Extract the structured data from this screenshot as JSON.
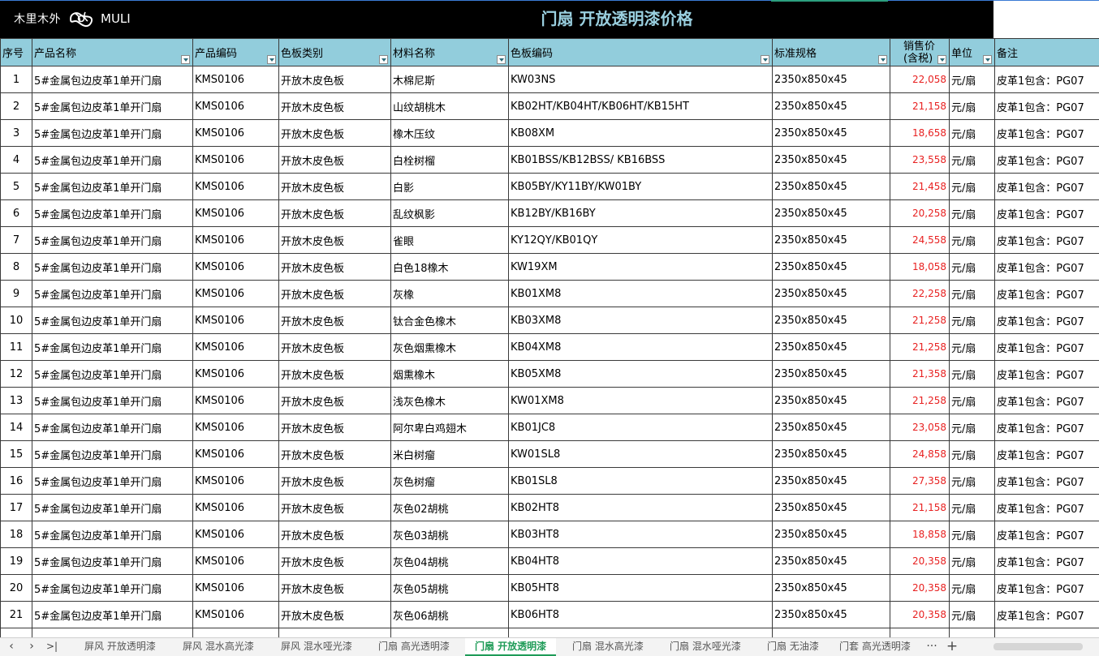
{
  "banner": {
    "logo_cn": "木里木外",
    "logo_en": "MULI",
    "title": "门扇 开放透明漆价格"
  },
  "table": {
    "headers": {
      "seq": "序号",
      "name": "产品名称",
      "code": "产品编码",
      "category": "色板类别",
      "material": "材料名称",
      "board": "色板编码",
      "spec": "标准规格",
      "price_line1": "销售价",
      "price_line2": "(含税)",
      "unit": "单位",
      "note": "备注"
    },
    "rows": [
      {
        "seq": "1",
        "name": "5#金属包边皮革1单开门扇",
        "code": "KMS0106",
        "category": "开放木皮色板",
        "material": "木棉尼斯",
        "board": "KW03NS",
        "spec": "2350x850x45",
        "price": "22,058",
        "unit": "元/扇",
        "note": "皮革1包含：PG07"
      },
      {
        "seq": "2",
        "name": "5#金属包边皮革1单开门扇",
        "code": "KMS0106",
        "category": "开放木皮色板",
        "material": "山纹胡桃木",
        "board": "KB02HT/KB04HT/KB06HT/KB15HT",
        "spec": "2350x850x45",
        "price": "21,158",
        "unit": "元/扇",
        "note": "皮革1包含：PG07"
      },
      {
        "seq": "3",
        "name": "5#金属包边皮革1单开门扇",
        "code": "KMS0106",
        "category": "开放木皮色板",
        "material": "橡木压纹",
        "board": "KB08XM",
        "spec": "2350x850x45",
        "price": "18,658",
        "unit": "元/扇",
        "note": "皮革1包含：PG07"
      },
      {
        "seq": "4",
        "name": "5#金属包边皮革1单开门扇",
        "code": "KMS0106",
        "category": "开放木皮色板",
        "material": "白栓树榴",
        "board": "KB01BSS/KB12BSS/ KB16BSS",
        "spec": "2350x850x45",
        "price": "23,558",
        "unit": "元/扇",
        "note": "皮革1包含：PG07"
      },
      {
        "seq": "5",
        "name": "5#金属包边皮革1单开门扇",
        "code": "KMS0106",
        "category": "开放木皮色板",
        "material": "白影",
        "board": "KB05BY/KY11BY/KW01BY",
        "spec": "2350x850x45",
        "price": "21,458",
        "unit": "元/扇",
        "note": "皮革1包含：PG07"
      },
      {
        "seq": "6",
        "name": "5#金属包边皮革1单开门扇",
        "code": "KMS0106",
        "category": "开放木皮色板",
        "material": "乱纹枫影",
        "board": "KB12BY/KB16BY",
        "spec": "2350x850x45",
        "price": "20,258",
        "unit": "元/扇",
        "note": "皮革1包含：PG07"
      },
      {
        "seq": "7",
        "name": "5#金属包边皮革1单开门扇",
        "code": "KMS0106",
        "category": "开放木皮色板",
        "material": "雀眼",
        "board": "KY12QY/KB01QY",
        "spec": "2350x850x45",
        "price": "24,558",
        "unit": "元/扇",
        "note": "皮革1包含：PG07"
      },
      {
        "seq": "8",
        "name": "5#金属包边皮革1单开门扇",
        "code": "KMS0106",
        "category": "开放木皮色板",
        "material": "白色18橡木",
        "board": "KW19XM",
        "spec": "2350x850x45",
        "price": "18,058",
        "unit": "元/扇",
        "note": "皮革1包含：PG07"
      },
      {
        "seq": "9",
        "name": "5#金属包边皮革1单开门扇",
        "code": "KMS0106",
        "category": "开放木皮色板",
        "material": "灰橡",
        "board": "KB01XM8",
        "spec": "2350x850x45",
        "price": "22,258",
        "unit": "元/扇",
        "note": "皮革1包含：PG07"
      },
      {
        "seq": "10",
        "name": "5#金属包边皮革1单开门扇",
        "code": "KMS0106",
        "category": "开放木皮色板",
        "material": "钛合金色橡木",
        "board": "KB03XM8",
        "spec": "2350x850x45",
        "price": "21,258",
        "unit": "元/扇",
        "note": "皮革1包含：PG07"
      },
      {
        "seq": "11",
        "name": "5#金属包边皮革1单开门扇",
        "code": "KMS0106",
        "category": "开放木皮色板",
        "material": "灰色烟熏橡木",
        "board": "KB04XM8",
        "spec": "2350x850x45",
        "price": "21,258",
        "unit": "元/扇",
        "note": "皮革1包含：PG07"
      },
      {
        "seq": "12",
        "name": "5#金属包边皮革1单开门扇",
        "code": "KMS0106",
        "category": "开放木皮色板",
        "material": "烟熏橡木",
        "board": "KB05XM8",
        "spec": "2350x850x45",
        "price": "21,358",
        "unit": "元/扇",
        "note": "皮革1包含：PG07"
      },
      {
        "seq": "13",
        "name": "5#金属包边皮革1单开门扇",
        "code": "KMS0106",
        "category": "开放木皮色板",
        "material": "浅灰色橡木",
        "board": "KW01XM8",
        "spec": "2350x850x45",
        "price": "21,258",
        "unit": "元/扇",
        "note": "皮革1包含：PG07"
      },
      {
        "seq": "14",
        "name": "5#金属包边皮革1单开门扇",
        "code": "KMS0106",
        "category": "开放木皮色板",
        "material": "阿尔卑白鸡翅木",
        "board": "KB01JC8",
        "spec": "2350x850x45",
        "price": "23,058",
        "unit": "元/扇",
        "note": "皮革1包含：PG07"
      },
      {
        "seq": "15",
        "name": "5#金属包边皮革1单开门扇",
        "code": "KMS0106",
        "category": "开放木皮色板",
        "material": "米白树瘤",
        "board": "KW01SL8",
        "spec": "2350x850x45",
        "price": "24,858",
        "unit": "元/扇",
        "note": "皮革1包含：PG07"
      },
      {
        "seq": "16",
        "name": "5#金属包边皮革1单开门扇",
        "code": "KMS0106",
        "category": "开放木皮色板",
        "material": "灰色树瘤",
        "board": "KB01SL8",
        "spec": "2350x850x45",
        "price": "27,358",
        "unit": "元/扇",
        "note": "皮革1包含：PG07"
      },
      {
        "seq": "17",
        "name": "5#金属包边皮革1单开门扇",
        "code": "KMS0106",
        "category": "开放木皮色板",
        "material": "灰色02胡桃",
        "board": "KB02HT8",
        "spec": "2350x850x45",
        "price": "21,158",
        "unit": "元/扇",
        "note": "皮革1包含：PG07"
      },
      {
        "seq": "18",
        "name": "5#金属包边皮革1单开门扇",
        "code": "KMS0106",
        "category": "开放木皮色板",
        "material": "灰色03胡桃",
        "board": "KB03HT8",
        "spec": "2350x850x45",
        "price": "18,858",
        "unit": "元/扇",
        "note": "皮革1包含：PG07"
      },
      {
        "seq": "19",
        "name": "5#金属包边皮革1单开门扇",
        "code": "KMS0106",
        "category": "开放木皮色板",
        "material": "灰色04胡桃",
        "board": "KB04HT8",
        "spec": "2350x850x45",
        "price": "20,358",
        "unit": "元/扇",
        "note": "皮革1包含：PG07"
      },
      {
        "seq": "20",
        "name": "5#金属包边皮革1单开门扇",
        "code": "KMS0106",
        "category": "开放木皮色板",
        "material": "灰色05胡桃",
        "board": "KB05HT8",
        "spec": "2350x850x45",
        "price": "20,358",
        "unit": "元/扇",
        "note": "皮革1包含：PG07"
      },
      {
        "seq": "21",
        "name": "5#金属包边皮革1单开门扇",
        "code": "KMS0106",
        "category": "开放木皮色板",
        "material": "灰色06胡桃",
        "board": "KB06HT8",
        "spec": "2350x850x45",
        "price": "20,358",
        "unit": "元/扇",
        "note": "皮革1包含：PG07"
      }
    ]
  },
  "tabs": [
    {
      "label": "屏风 开放透明漆",
      "active": false
    },
    {
      "label": "屏风 混水高光漆",
      "active": false
    },
    {
      "label": "屏风 混水哑光漆",
      "active": false
    },
    {
      "label": "门扇 高光透明漆",
      "active": false
    },
    {
      "label": "门扇 开放透明漆",
      "active": true
    },
    {
      "label": "门扇 混水高光漆",
      "active": false
    },
    {
      "label": "门扇 混水哑光漆",
      "active": false
    },
    {
      "label": "门扇 无油漆",
      "active": false
    },
    {
      "label": "门套 高光透明漆",
      "active": false
    }
  ],
  "tabbar": {
    "prev_icon": "‹",
    "next_icon": "›",
    "last_icon": ">|",
    "more_icon": "···",
    "add_icon": "+"
  },
  "colors": {
    "header_bg": "#92cddc",
    "price_text": "#e82020",
    "title_text": "#9ad0e0",
    "active_tab": "#1e9b57"
  }
}
